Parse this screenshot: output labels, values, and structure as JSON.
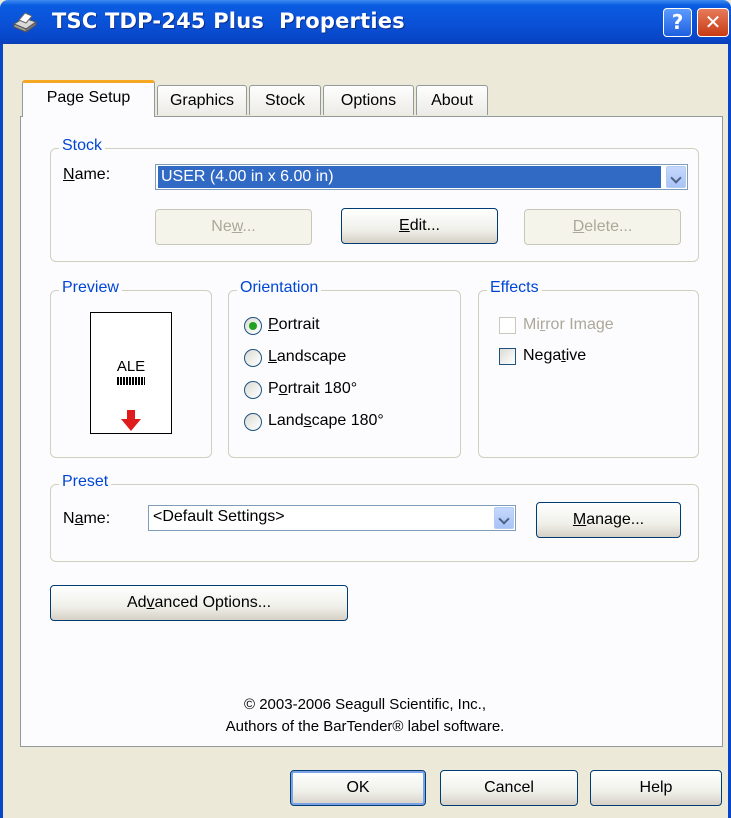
{
  "window": {
    "title": "TSC TDP-245 Plus  Properties",
    "help_glyph": "?",
    "close_glyph": "✕"
  },
  "tabs": [
    {
      "label": "Page Setup"
    },
    {
      "label": "Graphics"
    },
    {
      "label": "Stock"
    },
    {
      "label": "Options"
    },
    {
      "label": "About"
    }
  ],
  "stock": {
    "legend": "Stock",
    "name_label": "Name:",
    "name_value": "USER (4.00 in x 6.00 in)",
    "new_label": "New...",
    "edit_label": "Edit...",
    "delete_label": "Delete..."
  },
  "preview": {
    "legend": "Preview",
    "sample_text": "ALE"
  },
  "orientation": {
    "legend": "Orientation",
    "options": [
      {
        "label": "Portrait",
        "selected": true
      },
      {
        "label": "Landscape",
        "selected": false
      },
      {
        "label": "Portrait 180°",
        "selected": false
      },
      {
        "label": "Landscape 180°",
        "selected": false
      }
    ]
  },
  "effects": {
    "legend": "Effects",
    "mirror_label": "Mirror Image",
    "negative_label": "Negative"
  },
  "preset": {
    "legend": "Preset",
    "name_label": "Name:",
    "name_value": "<Default Settings>",
    "manage_label": "Manage..."
  },
  "advanced_label": "Advanced Options...",
  "copyright": {
    "line1": "© 2003-2006 Seagull Scientific, Inc.,",
    "line2": "Authors of the BarTender® label software."
  },
  "footer": {
    "ok": "OK",
    "cancel": "Cancel",
    "help": "Help"
  },
  "colors": {
    "titlebar": "#0a52d8",
    "legend_text": "#0046d5",
    "selection": "#316ac5",
    "tab_highlight": "#f5a623"
  }
}
